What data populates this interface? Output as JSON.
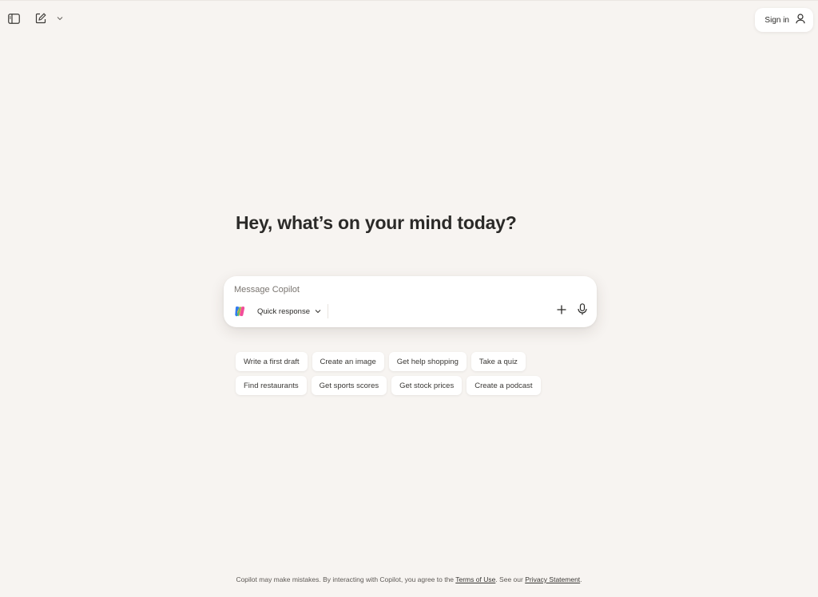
{
  "header": {
    "sidebar_toggle_icon": "sidebar-icon",
    "new_chat_icon": "compose-icon",
    "new_chat_menu_icon": "chevron-down-icon",
    "sign_in_label": "Sign in",
    "sign_in_icon": "user-icon"
  },
  "main": {
    "headline": "Hey, what’s on your mind today?",
    "composer": {
      "placeholder": "Message Copilot",
      "value": "",
      "mode_label": "Quick response",
      "logo_icon": "copilot-logo-icon",
      "add_icon": "plus-icon",
      "mic_icon": "microphone-icon"
    },
    "suggestions": [
      [
        "Write a first draft",
        "Create an image",
        "Get help shopping",
        "Take a quiz"
      ],
      [
        "Find restaurants",
        "Get sports scores",
        "Get stock prices",
        "Create a podcast"
      ]
    ]
  },
  "footer": {
    "text_before": "Copilot may make mistakes. By interacting with Copilot, you agree to the ",
    "terms_link": "Terms of Use",
    "text_middle": ". See our ",
    "privacy_link": "Privacy Statement",
    "text_after": "."
  },
  "colors": {
    "background": "#f7f4f1",
    "card": "#ffffff",
    "text": "#2b2a28"
  }
}
